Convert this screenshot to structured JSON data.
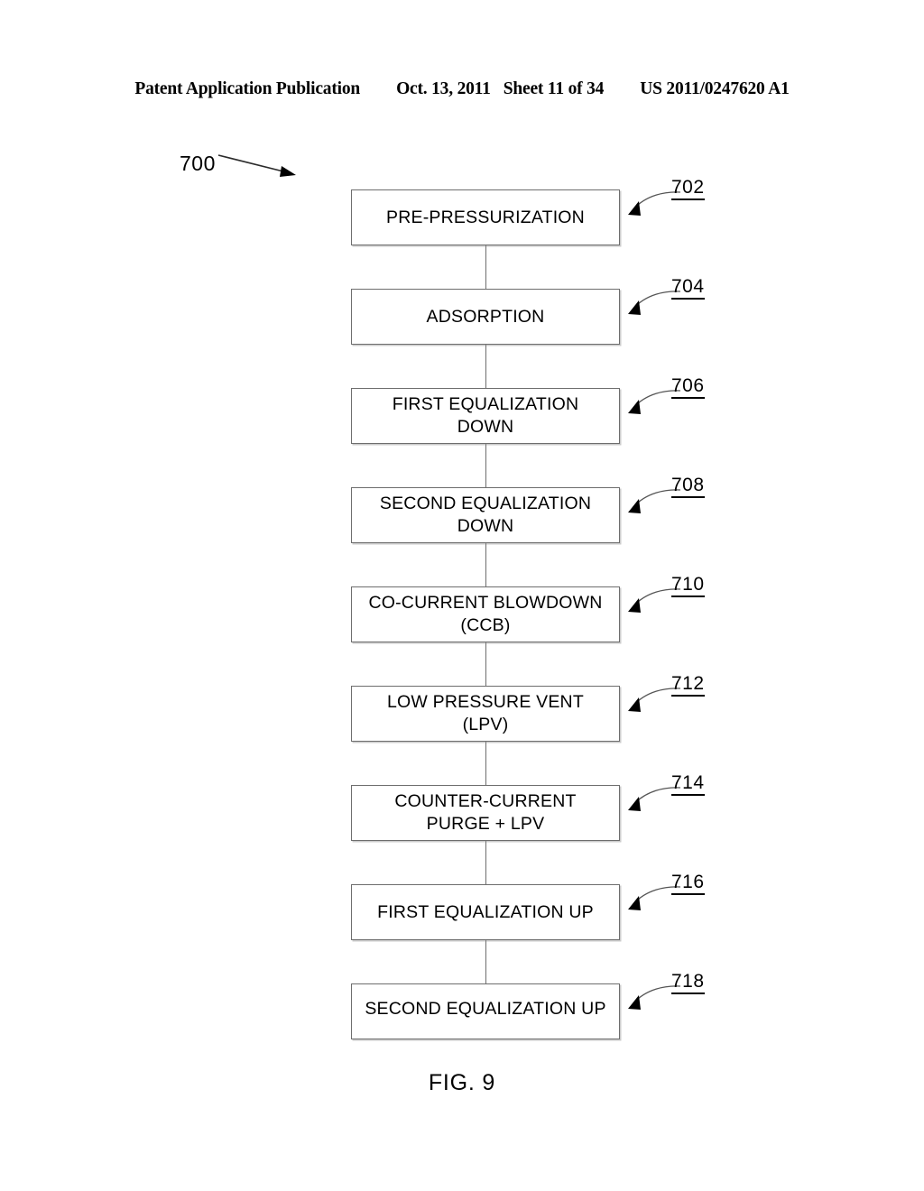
{
  "header": {
    "publication": "Patent Application Publication",
    "date": "Oct. 13, 2011",
    "sheet": "Sheet 11 of 34",
    "patent_number": "US 2011/0247620 A1"
  },
  "figure": {
    "caption": "FIG. 9",
    "diagram_ref": "700",
    "steps": [
      {
        "ref": "702",
        "label": "PRE-PRESSURIZATION"
      },
      {
        "ref": "704",
        "label": "ADSORPTION"
      },
      {
        "ref": "706",
        "label": "FIRST EQUALIZATION\nDOWN"
      },
      {
        "ref": "708",
        "label": "SECOND EQUALIZATION\nDOWN"
      },
      {
        "ref": "710",
        "label": "CO-CURRENT BLOWDOWN\n(CCB)"
      },
      {
        "ref": "712",
        "label": "LOW PRESSURE VENT\n(LPV)"
      },
      {
        "ref": "714",
        "label": "COUNTER-CURRENT\nPURGE + LPV"
      },
      {
        "ref": "716",
        "label": "FIRST EQUALIZATION UP"
      },
      {
        "ref": "718",
        "label": "SECOND EQUALIZATION UP"
      }
    ]
  },
  "colors": {
    "ink": "#000000",
    "line": "#6e6e6e",
    "page": "#ffffff"
  }
}
